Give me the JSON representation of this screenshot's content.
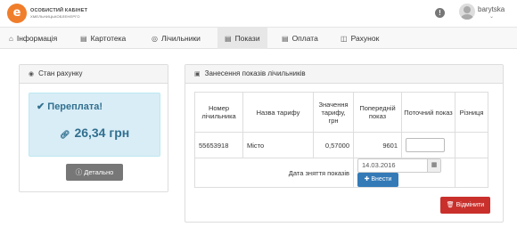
{
  "header": {
    "logo_title": "ОСОБИСТИЙ КАБІНЕТ",
    "logo_subtitle": "ХМЕЛЬНИЦЬКОБЛЕНЕРГО",
    "username": "barytska"
  },
  "nav": {
    "items": [
      {
        "label": "Інформація",
        "icon": "home-icon"
      },
      {
        "label": "Картотека",
        "icon": "card-icon"
      },
      {
        "label": "Лічильники",
        "icon": "dashboard-icon"
      },
      {
        "label": "Покази",
        "icon": "list-icon",
        "active": true
      },
      {
        "label": "Оплата",
        "icon": "credit-card-icon"
      },
      {
        "label": "Рахунок",
        "icon": "invoice-icon"
      }
    ]
  },
  "account": {
    "heading": "Стан рахунку",
    "status": "Переплата!",
    "amount": "26,34 грн",
    "details_button": "Детально"
  },
  "readings": {
    "heading": "Занесення показів лічильників",
    "columns": [
      "Номер лічильника",
      "Назва тарифу",
      "Значення тарифу, грн",
      "Попередній показ",
      "Поточний показ",
      "Різниця"
    ],
    "rows": [
      {
        "number": "55653918",
        "tariff": "Місто",
        "value": "0,57000",
        "previous": "9601",
        "current": "",
        "diff": ""
      }
    ],
    "date_label": "Дата зняття показів",
    "date_value": "14.03.2016",
    "submit_button": "Внести",
    "cancel_button": "Відмінити"
  }
}
